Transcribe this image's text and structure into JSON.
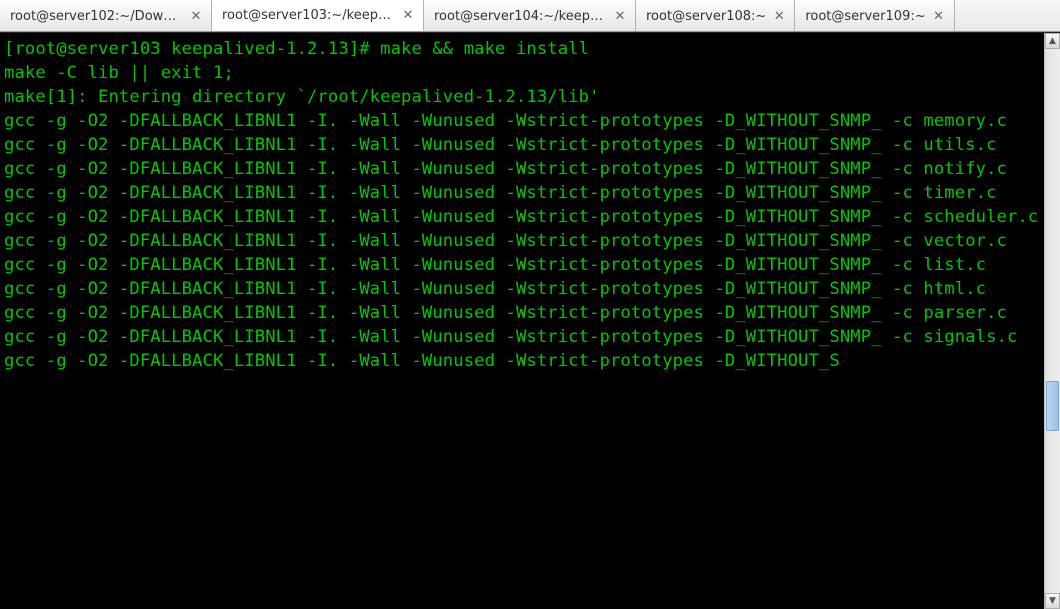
{
  "tabs": [
    {
      "label": "root@server102:~/Downl...",
      "active": false
    },
    {
      "label": "root@server103:~/keepa...",
      "active": true
    },
    {
      "label": "root@server104:~/keepa...",
      "active": false
    },
    {
      "label": "root@server108:~",
      "active": false
    },
    {
      "label": "root@server109:~",
      "active": false
    }
  ],
  "terminal": {
    "prompt": "[root@server103 keepalived-1.2.13]#",
    "command": "make && make install",
    "lines": [
      "make -C lib || exit 1;",
      "make[1]: Entering directory `/root/keepalived-1.2.13/lib'",
      "gcc -g -O2 -DFALLBACK_LIBNL1 -I. -Wall -Wunused -Wstrict-prototypes -D_WITHOUT_SNMP_ -c memory.c",
      "gcc -g -O2 -DFALLBACK_LIBNL1 -I. -Wall -Wunused -Wstrict-prototypes -D_WITHOUT_SNMP_ -c utils.c",
      "gcc -g -O2 -DFALLBACK_LIBNL1 -I. -Wall -Wunused -Wstrict-prototypes -D_WITHOUT_SNMP_ -c notify.c",
      "gcc -g -O2 -DFALLBACK_LIBNL1 -I. -Wall -Wunused -Wstrict-prototypes -D_WITHOUT_SNMP_ -c timer.c",
      "gcc -g -O2 -DFALLBACK_LIBNL1 -I. -Wall -Wunused -Wstrict-prototypes -D_WITHOUT_SNMP_ -c scheduler.c",
      "gcc -g -O2 -DFALLBACK_LIBNL1 -I. -Wall -Wunused -Wstrict-prototypes -D_WITHOUT_SNMP_ -c vector.c",
      "gcc -g -O2 -DFALLBACK_LIBNL1 -I. -Wall -Wunused -Wstrict-prototypes -D_WITHOUT_SNMP_ -c list.c",
      "gcc -g -O2 -DFALLBACK_LIBNL1 -I. -Wall -Wunused -Wstrict-prototypes -D_WITHOUT_SNMP_ -c html.c",
      "gcc -g -O2 -DFALLBACK_LIBNL1 -I. -Wall -Wunused -Wstrict-prototypes -D_WITHOUT_SNMP_ -c parser.c",
      "gcc -g -O2 -DFALLBACK_LIBNL1 -I. -Wall -Wunused -Wstrict-prototypes -D_WITHOUT_SNMP_ -c signals.c",
      "gcc -g -O2 -DFALLBACK_LIBNL1 -I. -Wall -Wunused -Wstrict-prototypes -D_WITHOUT_S"
    ]
  },
  "scrollbar": {
    "up_glyph": "▲",
    "down_glyph": "▼"
  }
}
